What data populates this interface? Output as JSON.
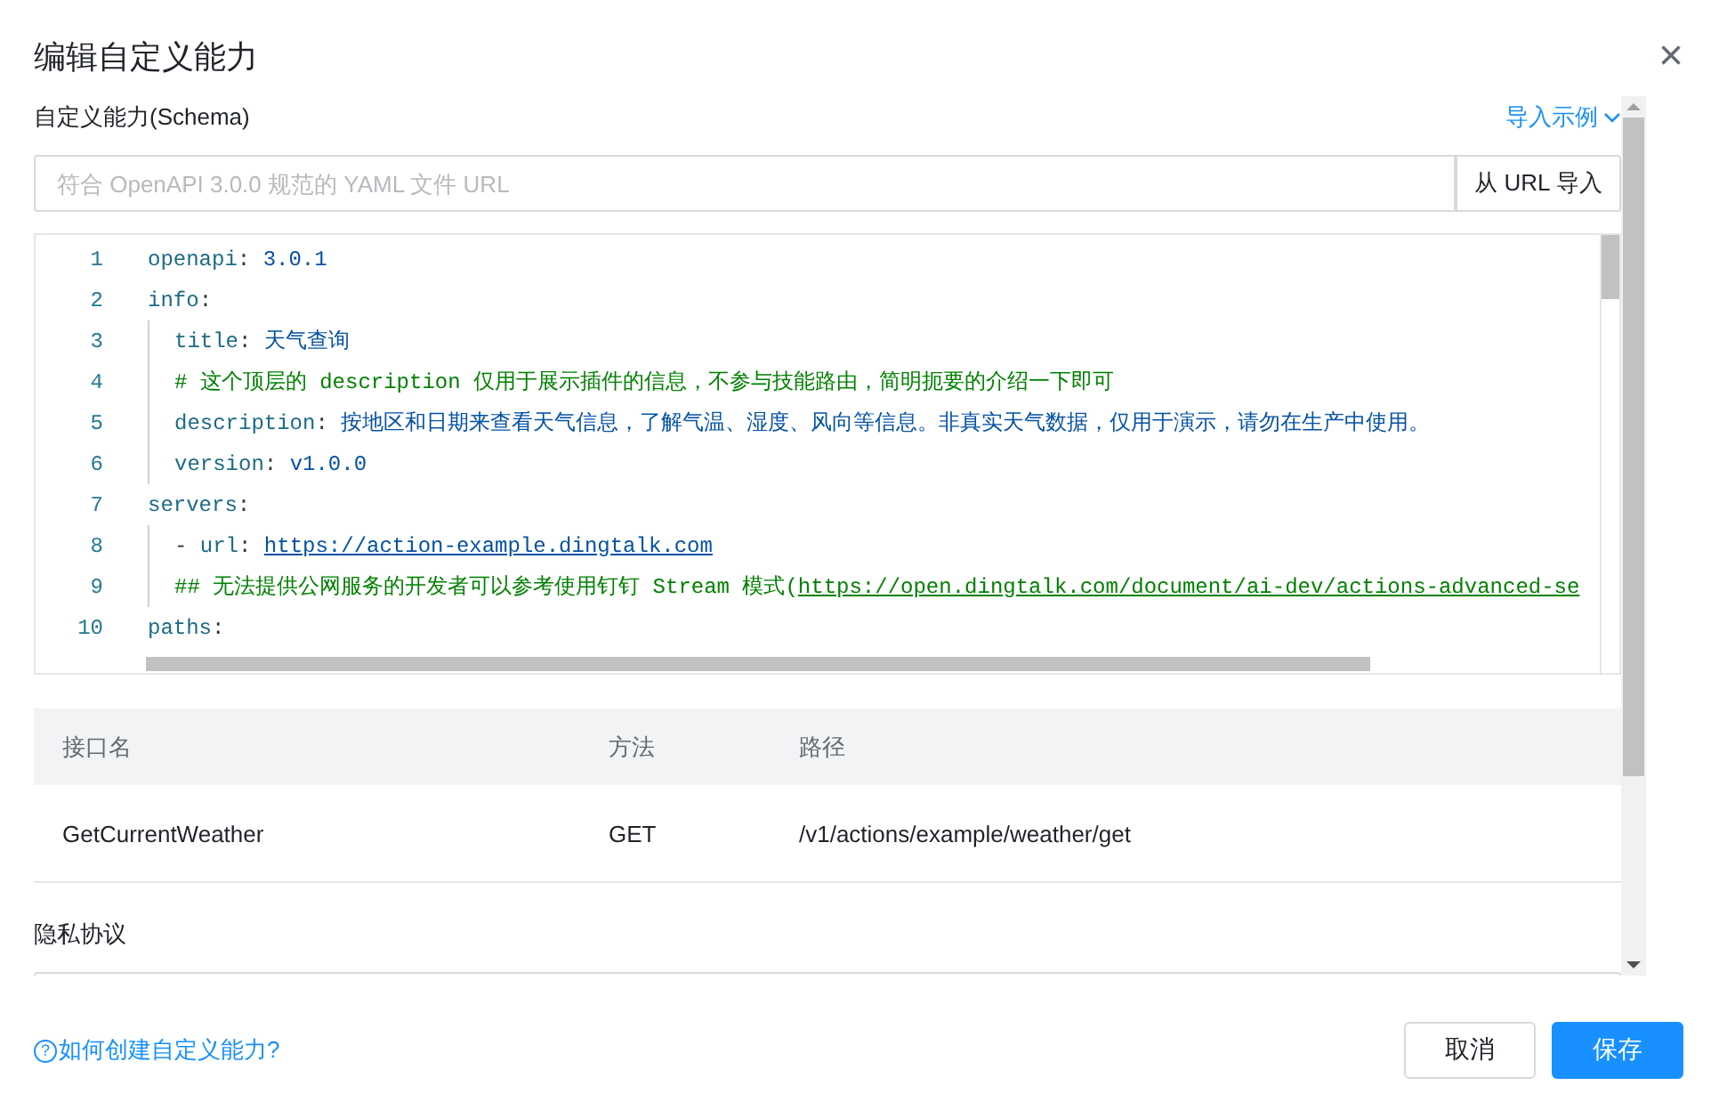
{
  "dialog": {
    "title": "编辑自定义能力",
    "close": "×"
  },
  "schema": {
    "label": "自定义能力(Schema)",
    "example_link": "导入示例",
    "url_field": {
      "placeholder": "符合 OpenAPI 3.0.0 规范的 YAML 文件 URL"
    },
    "import_button": "从 URL 导入"
  },
  "code_editor": {
    "lines": [
      {
        "number": "1",
        "segments": [
          {
            "kind": "key",
            "text": "openapi"
          },
          {
            "kind": "punct",
            "text": ": "
          },
          {
            "kind": "value",
            "text": "3.0.1"
          }
        ]
      },
      {
        "number": "2",
        "segments": [
          {
            "kind": "key",
            "text": "info"
          },
          {
            "kind": "punct",
            "text": ":"
          }
        ],
        "children": [
          {
            "number": "3",
            "segments": [
              {
                "kind": "key",
                "text": "title"
              },
              {
                "kind": "punct",
                "text": ": "
              },
              {
                "kind": "value",
                "text": "天气查询"
              }
            ]
          },
          {
            "number": "4",
            "segments": [
              {
                "kind": "comment",
                "text": "# 这个顶层的 description 仅用于展示插件的信息，不参与技能路由，简明扼要的介绍一下即可"
              }
            ]
          },
          {
            "number": "5",
            "segments": [
              {
                "kind": "key",
                "text": "description"
              },
              {
                "kind": "punct",
                "text": ": "
              },
              {
                "kind": "value",
                "text": "按地区和日期来查看天气信息，了解气温、湿度、风向等信息。非真实天气数据，仅用于演示，请勿在生产中使用。"
              }
            ]
          },
          {
            "number": "6",
            "segments": [
              {
                "kind": "key",
                "text": "version"
              },
              {
                "kind": "punct",
                "text": ": "
              },
              {
                "kind": "value",
                "text": "v1.0.0"
              }
            ]
          }
        ]
      },
      {
        "number": "7",
        "segments": [
          {
            "kind": "key",
            "text": "servers"
          },
          {
            "kind": "punct",
            "text": ":"
          }
        ],
        "children": [
          {
            "number": "8",
            "segments": [
              {
                "kind": "punct",
                "text": "- "
              },
              {
                "kind": "key",
                "text": "url"
              },
              {
                "kind": "punct",
                "text": ": "
              },
              {
                "kind": "link",
                "text": "https://action-example.dingtalk.com"
              }
            ]
          },
          {
            "number": "9",
            "segments": [
              {
                "kind": "comment",
                "text": "## 无法提供公网服务的开发者可以参考使用钉钉 Stream 模式("
              },
              {
                "kind": "comment_link",
                "text": "https://open.dingtalk.com/document/ai-dev/actions-advanced-se"
              }
            ]
          }
        ]
      },
      {
        "number": "10",
        "segments": [
          {
            "kind": "key",
            "text": "paths"
          },
          {
            "kind": "punct",
            "text": ":"
          }
        ]
      }
    ]
  },
  "table": {
    "columns": [
      "接口名",
      "方法",
      "路径"
    ],
    "rows": [
      [
        "GetCurrentWeather",
        "GET",
        "/v1/actions/example/weather/get"
      ]
    ]
  },
  "privacy": {
    "label": "隐私协议"
  },
  "footer": {
    "help_link": "如何创建自定义能力?",
    "help_icon": "?",
    "buttons": [
      {
        "label": "取消",
        "kind": "default"
      },
      {
        "label": "保存",
        "kind": "primary"
      }
    ]
  }
}
